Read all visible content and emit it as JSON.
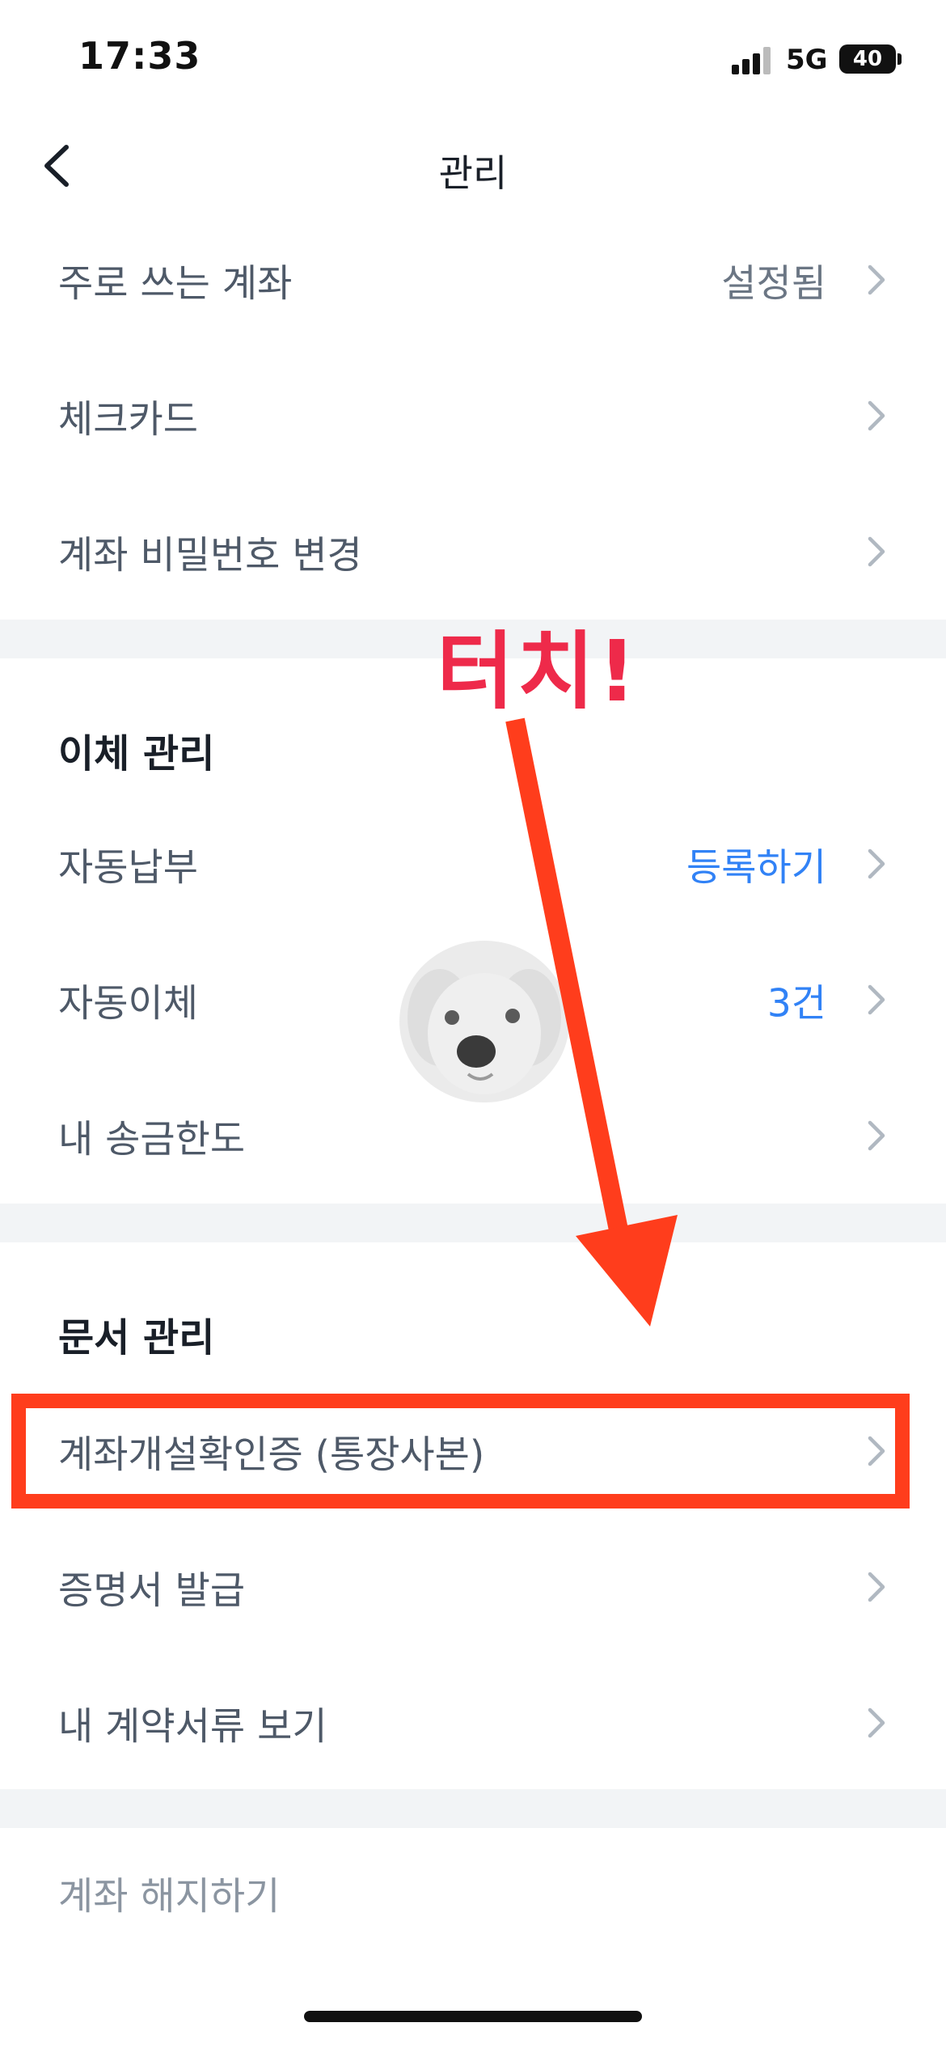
{
  "status_bar": {
    "time": "17:33",
    "network": "5G",
    "battery": "40"
  },
  "header": {
    "title": "관리"
  },
  "account_section": {
    "items": [
      {
        "label": "주로 쓰는 계좌",
        "value": "설정됨"
      },
      {
        "label": "체크카드",
        "value": ""
      },
      {
        "label": "계좌 비밀번호 변경",
        "value": ""
      }
    ]
  },
  "transfer_section": {
    "title": "이체 관리",
    "items": [
      {
        "label": "자동납부",
        "value": "등록하기"
      },
      {
        "label": "자동이체",
        "value": "3건"
      },
      {
        "label": "내 송금한도",
        "value": ""
      }
    ]
  },
  "document_section": {
    "title": "문서 관리",
    "items": [
      {
        "label": "계좌개설확인증 (통장사본)",
        "value": ""
      },
      {
        "label": "증명서 발급",
        "value": ""
      },
      {
        "label": "내 계약서류 보기",
        "value": ""
      }
    ]
  },
  "close_account": {
    "label": "계좌 해지하기"
  },
  "annotation": {
    "touch_text": "터치!",
    "color": "#ff3d1c"
  },
  "colors": {
    "accent_blue": "#3182f6",
    "divider": "#f2f4f6",
    "text_primary": "#191f28",
    "text_secondary": "#4e5968"
  }
}
